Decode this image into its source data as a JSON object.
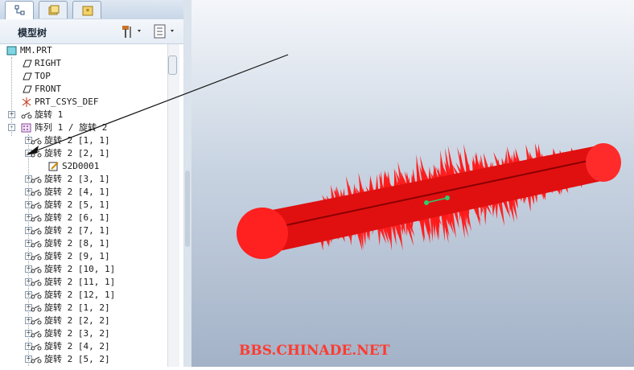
{
  "model_tree": {
    "title": "模型树",
    "items": [
      {
        "label": "MM.PRT",
        "icon": "part-icon"
      },
      {
        "label": "RIGHT",
        "icon": "datum-plane-icon"
      },
      {
        "label": "TOP",
        "icon": "datum-plane-icon"
      },
      {
        "label": "FRONT",
        "icon": "datum-plane-icon"
      },
      {
        "label": "PRT_CSYS_DEF",
        "icon": "csys-icon"
      },
      {
        "label": "旋转 1",
        "icon": "revolve-icon"
      },
      {
        "label": "阵列 1 / 旋转 2",
        "icon": "pattern-icon"
      },
      {
        "label": "旋转 2 [1, 1]",
        "icon": "revolve-icon"
      },
      {
        "label": "旋转 2 [2, 1]",
        "icon": "revolve-icon"
      },
      {
        "label": "S2D0001",
        "icon": "sketch-icon"
      },
      {
        "label": "旋转 2 [3, 1]",
        "icon": "revolve-icon"
      },
      {
        "label": "旋转 2 [4, 1]",
        "icon": "revolve-icon"
      },
      {
        "label": "旋转 2 [5, 1]",
        "icon": "revolve-icon"
      },
      {
        "label": "旋转 2 [6, 1]",
        "icon": "revolve-icon"
      },
      {
        "label": "旋转 2 [7, 1]",
        "icon": "revolve-icon"
      },
      {
        "label": "旋转 2 [8, 1]",
        "icon": "revolve-icon"
      },
      {
        "label": "旋转 2 [9, 1]",
        "icon": "revolve-icon"
      },
      {
        "label": "旋转 2 [10, 1]",
        "icon": "revolve-icon"
      },
      {
        "label": "旋转 2 [11, 1]",
        "icon": "revolve-icon"
      },
      {
        "label": "旋转 2 [12, 1]",
        "icon": "revolve-icon"
      },
      {
        "label": "旋转 2 [1, 2]",
        "icon": "revolve-icon"
      },
      {
        "label": "旋转 2 [2, 2]",
        "icon": "revolve-icon"
      },
      {
        "label": "旋转 2 [3, 2]",
        "icon": "revolve-icon"
      },
      {
        "label": "旋转 2 [4, 2]",
        "icon": "revolve-icon"
      },
      {
        "label": "旋转 2 [5, 2]",
        "icon": "revolve-icon"
      }
    ]
  },
  "viewport": {
    "model_color": "#ff1a1a"
  },
  "watermark": "BBS.CHINADE.NET"
}
